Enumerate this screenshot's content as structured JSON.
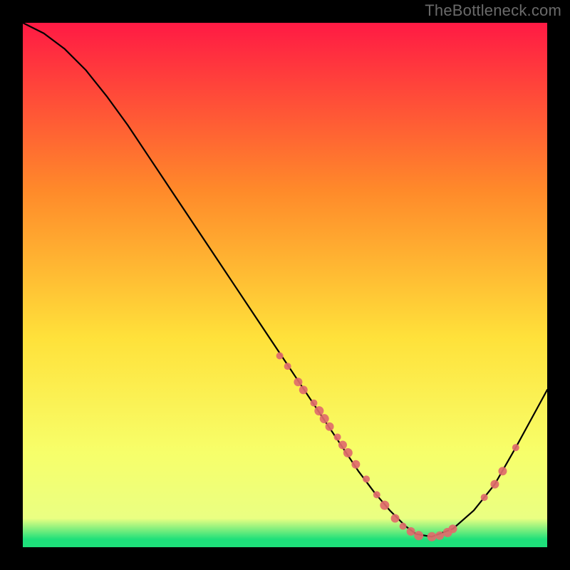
{
  "watermark": "TheBottleneck.com",
  "colors": {
    "background": "#000000",
    "curve": "#000000",
    "points": "#df6b6b",
    "gradient_top": "#ff1a44",
    "gradient_mid_upper": "#ff8a2a",
    "gradient_mid": "#ffe13a",
    "gradient_mid_lower": "#f7ff6a",
    "gradient_band": "#eaff82",
    "gradient_bottom": "#1ee07a"
  },
  "chart_data": {
    "type": "line",
    "title": "",
    "xlabel": "",
    "ylabel": "",
    "xlim": [
      0,
      100
    ],
    "ylim": [
      0,
      100
    ],
    "series": [
      {
        "name": "curve",
        "x": [
          0,
          4,
          8,
          12,
          16,
          20,
          24,
          28,
          32,
          36,
          40,
          44,
          48,
          52,
          56,
          60,
          64,
          67,
          70,
          73,
          75,
          78,
          82,
          86,
          90,
          94,
          100
        ],
        "y": [
          100,
          98,
          95,
          91,
          86,
          80.5,
          74.5,
          68.5,
          62.5,
          56.5,
          50.5,
          44.5,
          38.5,
          32.5,
          26.5,
          20.5,
          14.5,
          10.5,
          7,
          4,
          2.5,
          2,
          3.5,
          7,
          12,
          19,
          30
        ]
      }
    ],
    "points": {
      "name": "markers",
      "x": [
        49,
        50.5,
        52.5,
        53.5,
        55.5,
        56.5,
        57.5,
        58.5,
        60,
        61,
        62,
        63.5,
        65.5,
        67.5,
        69,
        71,
        72.5,
        74,
        75.5,
        78,
        79.5,
        81,
        82,
        88,
        90,
        91.5,
        94
      ],
      "y": [
        36.5,
        34.5,
        31.5,
        30,
        27.5,
        26,
        24.5,
        23,
        21,
        19.5,
        18,
        15.8,
        13,
        10,
        8,
        5.5,
        4,
        3,
        2.2,
        2,
        2.2,
        2.8,
        3.5,
        9.5,
        12,
        14.5,
        19
      ],
      "r": [
        5,
        5,
        6,
        6,
        5,
        6.5,
        6.5,
        6,
        5,
        6,
        6.5,
        6,
        5,
        5,
        6.5,
        6,
        5,
        6,
        6.5,
        6.5,
        6,
        6.5,
        6,
        5,
        6,
        6,
        5
      ]
    }
  }
}
